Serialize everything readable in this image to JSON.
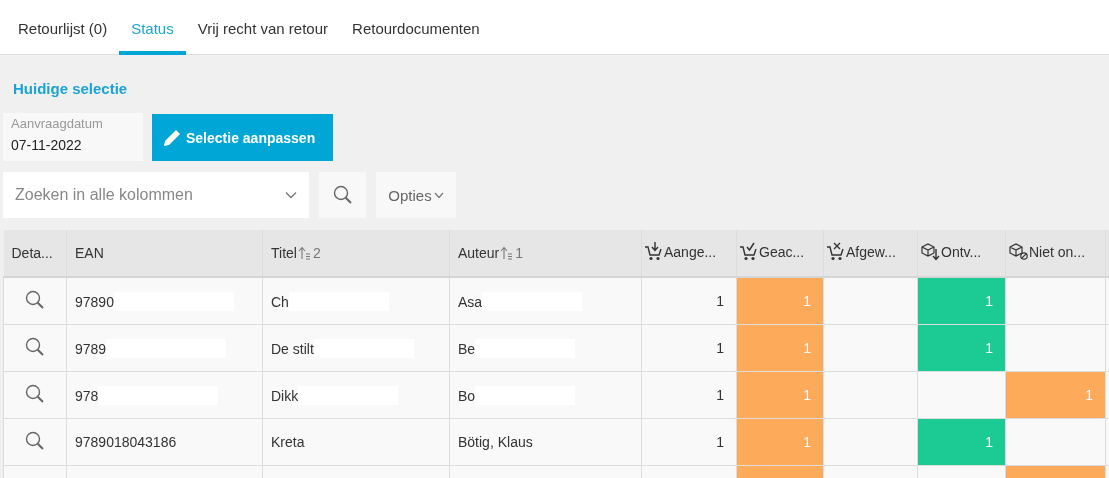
{
  "tabs": [
    {
      "label": "Retourlijst (0)",
      "selected": false
    },
    {
      "label": "Status",
      "selected": true
    },
    {
      "label": "Vrij recht van retour",
      "selected": false
    },
    {
      "label": "Retourdocumenten",
      "selected": false
    }
  ],
  "selection": {
    "title": "Huidige selectie",
    "date_field": {
      "label": "Aanvraagdatum",
      "value": "07-11-2022"
    },
    "edit_button": "Selectie aanpassen"
  },
  "search": {
    "placeholder": "Zoeken in alle kolommen",
    "options_button": "Opties"
  },
  "table": {
    "columns": [
      {
        "label": "Deta...",
        "kind": "detail"
      },
      {
        "label": "EAN",
        "kind": "text"
      },
      {
        "label": "Titel",
        "kind": "text",
        "sort_rank": "2"
      },
      {
        "label": "Auteur",
        "kind": "text",
        "sort_rank": "1"
      },
      {
        "label": "Aange...",
        "kind": "count"
      },
      {
        "label": "Geac...",
        "kind": "count"
      },
      {
        "label": "Afgew...",
        "kind": "count"
      },
      {
        "label": "Ontv...",
        "kind": "count"
      },
      {
        "label": "Niet on...",
        "kind": "count"
      }
    ],
    "rows": [
      {
        "texts": [
          {
            "text": "97890",
            "redacted": true
          },
          {
            "text": "Ch",
            "redacted": true
          },
          {
            "text": "Asa",
            "redacted": true
          }
        ],
        "counts": [
          {
            "kind": "value",
            "value": "1"
          },
          {
            "kind": "value",
            "value": "1",
            "color": "#fdaa5a"
          },
          {
            "kind": "blank"
          },
          {
            "kind": "value",
            "value": "1",
            "color": "#1ccb94"
          },
          {
            "kind": "blank"
          }
        ]
      },
      {
        "texts": [
          {
            "text": "9789",
            "redacted": true
          },
          {
            "text": "De stilt",
            "redacted": true
          },
          {
            "text": "Be",
            "redacted": true
          }
        ],
        "counts": [
          {
            "kind": "value",
            "value": "1"
          },
          {
            "kind": "value",
            "value": "1",
            "color": "#fdaa5a"
          },
          {
            "kind": "blank"
          },
          {
            "kind": "value",
            "value": "1",
            "color": "#1ccb94"
          },
          {
            "kind": "blank"
          }
        ]
      },
      {
        "texts": [
          {
            "text": "978",
            "redacted": true
          },
          {
            "text": "Dikk",
            "redacted": true
          },
          {
            "text": "Bo",
            "redacted": true
          }
        ],
        "counts": [
          {
            "kind": "value",
            "value": "1"
          },
          {
            "kind": "value",
            "value": "1",
            "color": "#fdaa5a"
          },
          {
            "kind": "blank"
          },
          {
            "kind": "blank"
          },
          {
            "kind": "value",
            "value": "1",
            "color": "#fdaa5a"
          }
        ]
      },
      {
        "texts": [
          {
            "text": "9789018043186",
            "redacted": false
          },
          {
            "text": "Kreta",
            "redacted": false
          },
          {
            "text": "Bötig, Klaus",
            "redacted": false
          }
        ],
        "counts": [
          {
            "kind": "value",
            "value": "1"
          },
          {
            "kind": "value",
            "value": "1",
            "color": "#fdaa5a"
          },
          {
            "kind": "blank"
          },
          {
            "kind": "value",
            "value": "1",
            "color": "#1ccb94"
          },
          {
            "kind": "blank"
          }
        ]
      },
      {
        "counts": [
          {
            "kind": "blank"
          },
          {
            "kind": "fill",
            "color": "#fdaa5a"
          },
          {
            "kind": "blank"
          },
          {
            "kind": "blank"
          },
          {
            "kind": "fill",
            "color": "#fdaa5a"
          }
        ]
      }
    ]
  }
}
